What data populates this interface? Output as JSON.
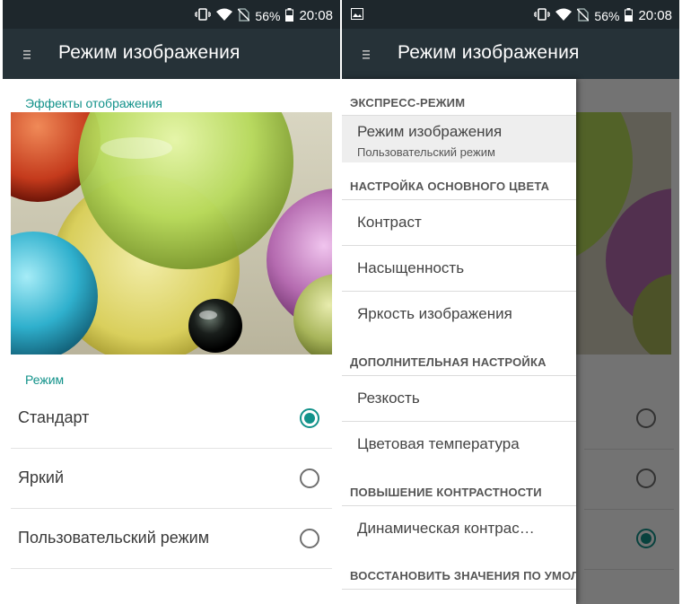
{
  "status": {
    "battery": "56%",
    "time": "20:08"
  },
  "colors": {
    "accent": "#12928a",
    "appbar": "#263238",
    "statusbar": "#1e272c"
  },
  "left": {
    "title": "Режим изображения",
    "effects_label": "Эффекты отображения",
    "mode_label": "Режим",
    "modes": [
      {
        "label": "Стандарт",
        "selected": true
      },
      {
        "label": "Яркий",
        "selected": false
      },
      {
        "label": "Пользовательский режим",
        "selected": false
      }
    ]
  },
  "right": {
    "title": "Режим изображения",
    "drawer": {
      "express_header": "ЭКСПРЕСС-РЕЖИМ",
      "express_item": {
        "title": "Режим изображения",
        "subtitle": "Пользовательский режим"
      },
      "basic_color_header": "НАСТРОЙКА ОСНОВНОГО ЦВЕТА",
      "contrast": "Контраст",
      "saturation": "Насыщенность",
      "brightness": "Яркость изображения",
      "advanced_header": "ДОПОЛНИТЕЛЬНАЯ НАСТРОЙКА",
      "sharpness": "Резкость",
      "color_temp": "Цветовая температура",
      "contrast_boost_header": "ПОВЫШЕНИЕ КОНТРАСТНОСТИ",
      "dynamic_contrast": "Динамическая контрас…",
      "restore_header": "ВОССТАНОВИТЬ ЗНАЧЕНИЯ ПО УМОЛЧАНИЮ"
    },
    "background_selected_index": 2
  },
  "icons": [
    "vibrate-icon",
    "wifi-icon",
    "no-sim-icon",
    "battery-icon",
    "image-notification-icon",
    "menu-icon",
    "radio-icon"
  ]
}
